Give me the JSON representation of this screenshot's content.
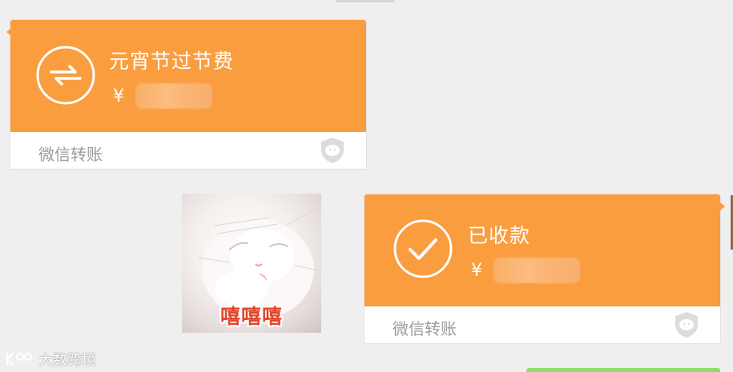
{
  "messages": [
    {
      "kind": "transfer",
      "side": "left",
      "icon": "transfer-arrows-icon",
      "title": "元宵节过节费",
      "currency": "¥",
      "amount_hidden": true,
      "footer_label": "微信转账",
      "footer_icon": "wechat-shield-icon",
      "header_color": "#f99d3f"
    },
    {
      "kind": "sticker",
      "side": "right",
      "caption": "嘻嘻嘻",
      "caption_color": "#e2462b"
    },
    {
      "kind": "transfer",
      "side": "right",
      "icon": "checkmark-circle-icon",
      "title": "已收款",
      "currency": "¥",
      "amount_hidden": true,
      "footer_label": "微信转账",
      "footer_icon": "wechat-shield-icon",
      "header_color": "#f99d3f"
    }
  ],
  "watermark": {
    "text": "大数跨境",
    "icon": "brand-logo-icon"
  }
}
